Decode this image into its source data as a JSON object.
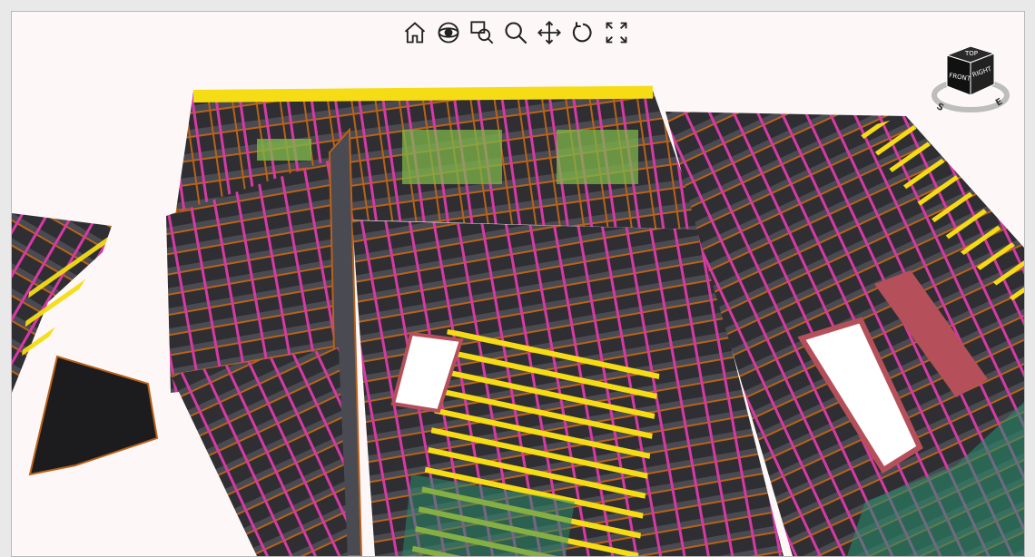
{
  "toolbar": {
    "buttons": [
      {
        "name": "home-button",
        "icon": "home-icon"
      },
      {
        "name": "orbit-button",
        "icon": "orbit-icon"
      },
      {
        "name": "zoom-window-button",
        "icon": "zoom-window-icon"
      },
      {
        "name": "zoom-button",
        "icon": "magnifier-icon"
      },
      {
        "name": "pan-button",
        "icon": "pan-arrows-icon"
      },
      {
        "name": "rotate-button",
        "icon": "rotate-icon"
      },
      {
        "name": "fullscreen-button",
        "icon": "fullscreen-icon"
      }
    ]
  },
  "viewcube": {
    "front_label": "FRONT",
    "right_label": "RIGHT",
    "top_label": "TOP",
    "compass": {
      "south": "S",
      "east": "E"
    }
  },
  "colors": {
    "background": "#fdf8f7",
    "rafter_dark": "#3a3a3e",
    "batten_orange": "#b8621a",
    "magenta": "#d63aa3",
    "highlight_yellow": "#f5dc14",
    "green": "#7fb54a",
    "teal": "#2a8a6a",
    "opening_red": "#b5505a"
  }
}
